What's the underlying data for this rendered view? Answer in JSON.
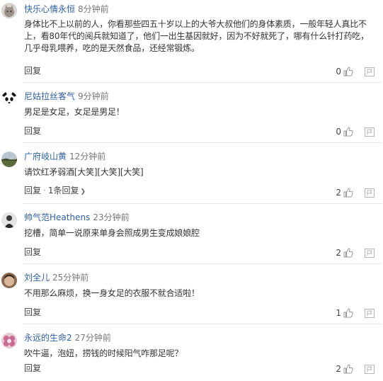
{
  "comments": [
    {
      "username": "快乐心情永恒",
      "time": "8分钟前",
      "lines": [
        "身体比不上以前的人，你看那些四五十岁以上的大爷大叔他们的身体素质，一般年轻人真比不",
        "上，看80年代的阅兵就知道了，他们一出生基因就好，因为不好就死了，哪有什么针打药吃，",
        "几乎母乳喂养，吃的是天然食品，还经常锻炼。"
      ],
      "reply": "回复",
      "likes": "0",
      "avatar_icon": "cat-avatar-icon"
    },
    {
      "username": "尼姑拉丝客气",
      "time": "9分钟前",
      "lines": [
        "男足是女足，女足是男足！"
      ],
      "reply": "回复",
      "likes": "0",
      "avatar_icon": "panda-avatar-icon"
    },
    {
      "username": "广府岐山黄",
      "time": "12分钟前",
      "lines": [
        "请饮红矛弱酒[大笑][大笑][大笑]"
      ],
      "reply": "回复",
      "reply_count": "1条回复",
      "likes": "2",
      "avatar_icon": "landscape-avatar-icon"
    },
    {
      "username": "帅气范Heathens",
      "time": "23分钟前",
      "lines": [
        "挖槽，简单一说原来单身会照成男生变成娘娘腔"
      ],
      "reply": "回复",
      "likes": "2",
      "avatar_icon": "figure-avatar-icon"
    },
    {
      "username": "刘全儿",
      "time": "25分钟前",
      "lines": [
        "不用那么麻烦，换一身女足的衣服不就合适啦！"
      ],
      "reply": "回复",
      "likes": "1",
      "avatar_icon": "face-avatar-icon"
    },
    {
      "username": "永远的生命2",
      "time": "27分钟前",
      "lines": [
        "吹牛逼，泡妞，捞钱的时候阳气咋那足呢？"
      ],
      "reply": "回复",
      "likes": "2",
      "avatar_icon": "flower-avatar-icon"
    }
  ]
}
